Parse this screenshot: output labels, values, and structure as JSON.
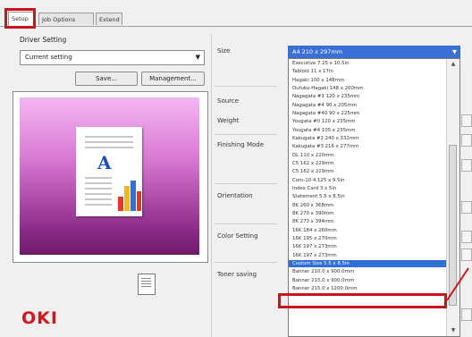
{
  "tabs": [
    {
      "label": "Setup"
    },
    {
      "label": "Job Options"
    },
    {
      "label": "Extend"
    }
  ],
  "driver_setting": {
    "label": "Driver Setting",
    "value": "Current setting",
    "save_label": "Save...",
    "management_label": "Management..."
  },
  "labels": {
    "size": "Size",
    "source": "Source",
    "weight": "Weight",
    "finishing": "Finishing Mode",
    "orientation": "Orientation",
    "color": "Color Setting",
    "toner": "Toner saving"
  },
  "size_select": {
    "value": "A4 210 x 297mm"
  },
  "size_options": [
    "Executive 7.25 x 10.5in",
    "Tabloid 11 x 17in",
    "Hagaki 100 x 148mm",
    "Oufuku-Hagaki 148 x 200mm",
    "Nagagata #3 120 x 235mm",
    "Nagagata #4 90 x 205mm",
    "Nagagata #40 90 x 225mm",
    "Yougata #0 120 x 235mm",
    "Yougata #4 105 x 235mm",
    "Kakugata #2 240 x 332mm",
    "Kakugata #3 216 x 277mm",
    "DL 110 x 220mm",
    "C5 162 x 229mm",
    "C5 162 x 229mm",
    "Com-10 4.125 x 9.5in",
    "Index Card 3 x 5in",
    "Statement 5.5 x 8.5in",
    "8K 260 x 368mm",
    "8K 270 x 390mm",
    "8K 273 x 394mm",
    "16K 184 x 260mm",
    "16K 195 x 270mm",
    "16K 197 x 273mm",
    "16K 197 x 273mm",
    "Custom Size 5.5 x 8.5in",
    "Banner 210.0 x 900.0mm",
    "Banner 215.0 x 900.0mm",
    "Banner 215.0 x 1200.0mm"
  ],
  "selected_index": 24,
  "brand": {
    "logo_text": "OKI",
    "color": "#d4141e"
  },
  "highlight_color": "#c8141e",
  "preview_colors": [
    "#f4b6f2",
    "#8a2a86"
  ],
  "icons": [
    "dropdown-arrow-icon",
    "document-preview-icon",
    "page-preview-icon"
  ]
}
